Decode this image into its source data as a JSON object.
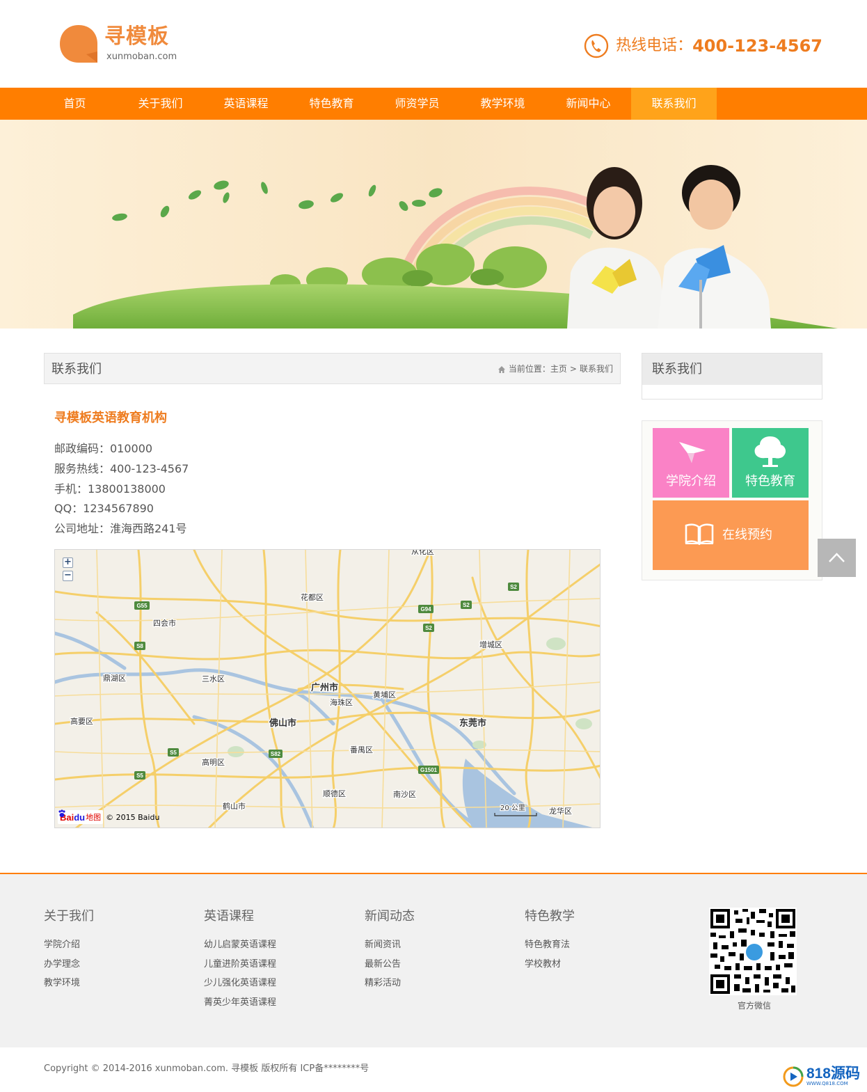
{
  "colors": {
    "accent": "#ff7e00",
    "accent_light": "#ffa31a",
    "title_orange": "#ee7c1f",
    "tile_pink": "#fa82c6",
    "tile_green": "#3ec88d",
    "tile_orange": "#fc9a53"
  },
  "header": {
    "logo_name": "寻模板",
    "logo_domain": "xunmoban.com",
    "hotline_label": "热线电话：",
    "hotline_number": "400-123-4567",
    "phone_icon": "phone-icon"
  },
  "nav": {
    "items": [
      {
        "label": "首页"
      },
      {
        "label": "关于我们"
      },
      {
        "label": "英语课程"
      },
      {
        "label": "特色教育"
      },
      {
        "label": "师资学员"
      },
      {
        "label": "教学环境"
      },
      {
        "label": "新闻中心"
      },
      {
        "label": "联系我们"
      }
    ],
    "active": "联系我们"
  },
  "content": {
    "title": "联系我们",
    "breadcrumb": {
      "prefix": "当前位置：",
      "home": "主页",
      "separator": ">",
      "current": "联系我们"
    },
    "org_name": "寻模板英语教育机构",
    "info": [
      "邮政编码：010000",
      "服务热线：400-123-4567",
      "手机：13800138000",
      "QQ：1234567890",
      "公司地址：淮海西路241号"
    ],
    "map": {
      "zoom_in": "+",
      "zoom_out": "−",
      "labels": {
        "huadu": "花都区",
        "sihui": "四会市",
        "dinghu": "鼎湖区",
        "sanshui": "三水区",
        "gaoyao": "高要区",
        "guangzhou": "广州市",
        "haizhu": "海珠区",
        "huangpu": "黄埔区",
        "foshan": "佛山市",
        "dongguan": "东莞市",
        "zengcheng": "增城区",
        "panyu": "番禺区",
        "gaoming": "高明区",
        "shunde": "顺德区",
        "nansha": "南沙区",
        "heshan": "鹤山市",
        "longhua": "龙华区",
        "conghua": "从化区",
        "scale": "20 公里"
      },
      "shields": {
        "g55": "G55",
        "s8": "S8",
        "s5a": "S5",
        "s5b": "S5",
        "s82": "S82",
        "g94": "G94",
        "s2a": "S2",
        "s2b": "S2",
        "s2c": "S2",
        "g1501": "G1501"
      },
      "attribution": {
        "bai": "Bai",
        "du": "du",
        "ditu": "地图",
        "copyright": "© 2015 Baidu"
      }
    }
  },
  "sidebar": {
    "title": "联系我们",
    "tiles": [
      {
        "label": "学院介绍",
        "icon": "paper-plane-icon"
      },
      {
        "label": "特色教育",
        "icon": "tree-icon"
      },
      {
        "label": "在线预约",
        "icon": "open-book-icon"
      }
    ],
    "back_to_top_icon": "chevron-up-icon"
  },
  "footer": {
    "columns": [
      {
        "title": "关于我们",
        "links": [
          "学院介绍",
          "办学理念",
          "教学环境"
        ]
      },
      {
        "title": "英语课程",
        "links": [
          "幼儿启蒙英语课程",
          "儿童进阶英语课程",
          "少儿强化英语课程",
          "菁英少年英语课程"
        ]
      },
      {
        "title": "新闻动态",
        "links": [
          "新闻资讯",
          "最新公告",
          "精彩活动"
        ]
      },
      {
        "title": "特色教学",
        "links": [
          "特色教育法",
          "学校教材"
        ]
      }
    ],
    "qr_label": "官方微信",
    "copyright": "Copyright © 2014-2016 xunmoban.com. 寻模板 版权所有 ICP备********号",
    "badge_number": "818源码",
    "badge_sub": "WWW.Q818.COM"
  }
}
